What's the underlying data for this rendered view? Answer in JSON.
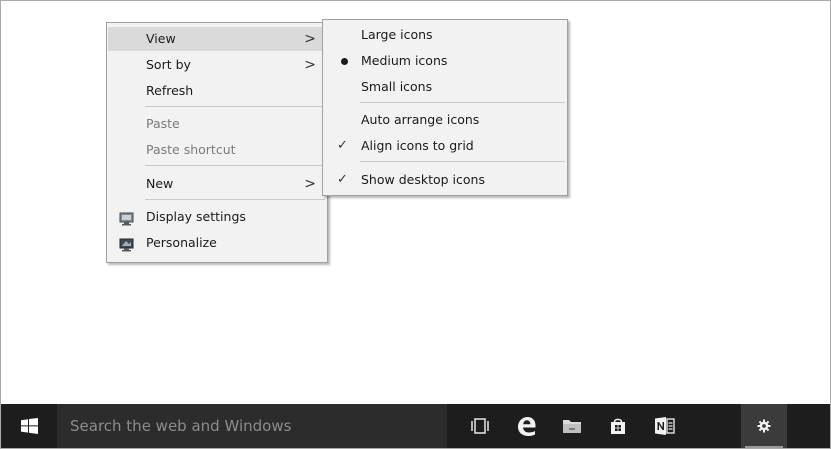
{
  "context_menu": {
    "items": [
      {
        "label": "View"
      },
      {
        "label": "Sort by"
      },
      {
        "label": "Refresh"
      },
      {
        "label": "Paste"
      },
      {
        "label": "Paste shortcut"
      },
      {
        "label": "New"
      },
      {
        "label": "Display settings",
        "icon": "display-settings-icon"
      },
      {
        "label": "Personalize",
        "icon": "personalize-icon"
      }
    ]
  },
  "view_submenu": {
    "items": [
      {
        "label": "Large icons"
      },
      {
        "label": "Medium icons",
        "selected": true
      },
      {
        "label": "Small icons"
      },
      {
        "label": "Auto arrange icons",
        "checked": false
      },
      {
        "label": "Align icons to grid",
        "checked": true
      },
      {
        "label": "Show desktop icons",
        "checked": true
      }
    ]
  },
  "taskbar": {
    "search_placeholder": "Search the web and Windows",
    "apps": [
      {
        "icon": "task-view-icon"
      },
      {
        "icon": "edge-browser-icon"
      },
      {
        "icon": "file-explorer-icon"
      },
      {
        "icon": "store-icon"
      },
      {
        "icon": "onenote-icon"
      },
      {
        "icon": "settings-gear-icon",
        "active": true
      }
    ]
  },
  "colors": {
    "taskbar_bg": "#1d1d1d",
    "search_bg": "#2c2c2c",
    "menu_bg": "#f2f2f2",
    "menu_highlight": "#dadada"
  }
}
